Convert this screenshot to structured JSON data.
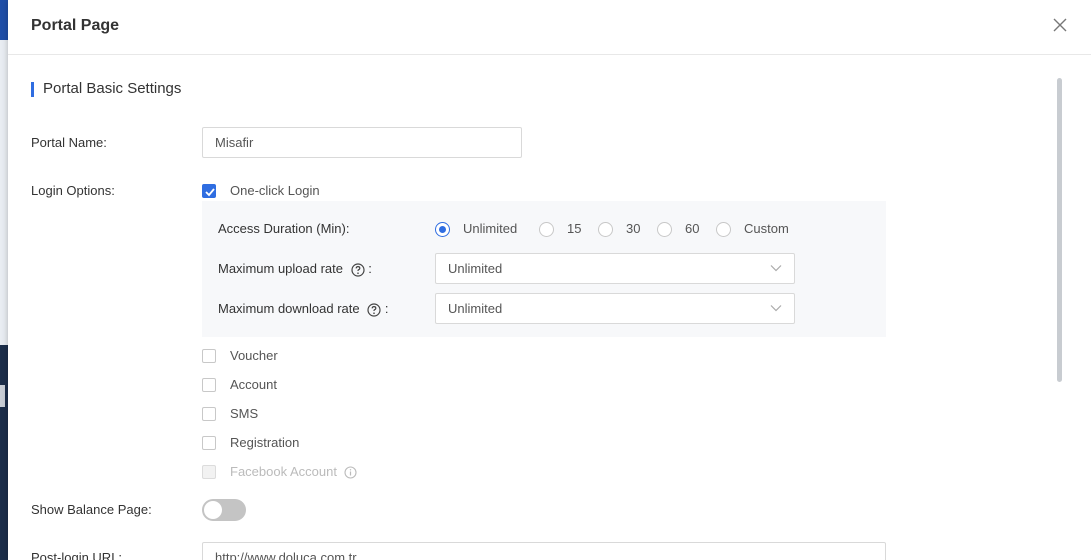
{
  "modal": {
    "title": "Portal Page"
  },
  "section": {
    "title": "Portal Basic Settings"
  },
  "portal_name": {
    "label": "Portal Name:",
    "value": "Misafir"
  },
  "login_options": {
    "label": "Login Options:",
    "one_click": {
      "label": "One-click Login",
      "checked": true
    },
    "access_duration": {
      "label": "Access Duration (Min):",
      "options": [
        "Unlimited",
        "15",
        "30",
        "60",
        "Custom"
      ],
      "selected": "Unlimited"
    },
    "upload_rate": {
      "label": "Maximum upload rate",
      "value": "Unlimited"
    },
    "download_rate": {
      "label": "Maximum download rate",
      "value": "Unlimited"
    },
    "colon": ":",
    "others": [
      {
        "label": "Voucher",
        "checked": false,
        "disabled": false
      },
      {
        "label": "Account",
        "checked": false,
        "disabled": false
      },
      {
        "label": "SMS",
        "checked": false,
        "disabled": false
      },
      {
        "label": "Registration",
        "checked": false,
        "disabled": false
      },
      {
        "label": "Facebook Account",
        "checked": false,
        "disabled": true
      }
    ]
  },
  "balance_page": {
    "label": "Show Balance Page:",
    "enabled": false
  },
  "post_login_url": {
    "label": "Post-login URL:",
    "value": "http://www.doluca.com.tr"
  },
  "colors": {
    "accent": "#2f6de1",
    "toggle_off": "#c4c4c4",
    "panel_bg": "#f7f8fa"
  }
}
